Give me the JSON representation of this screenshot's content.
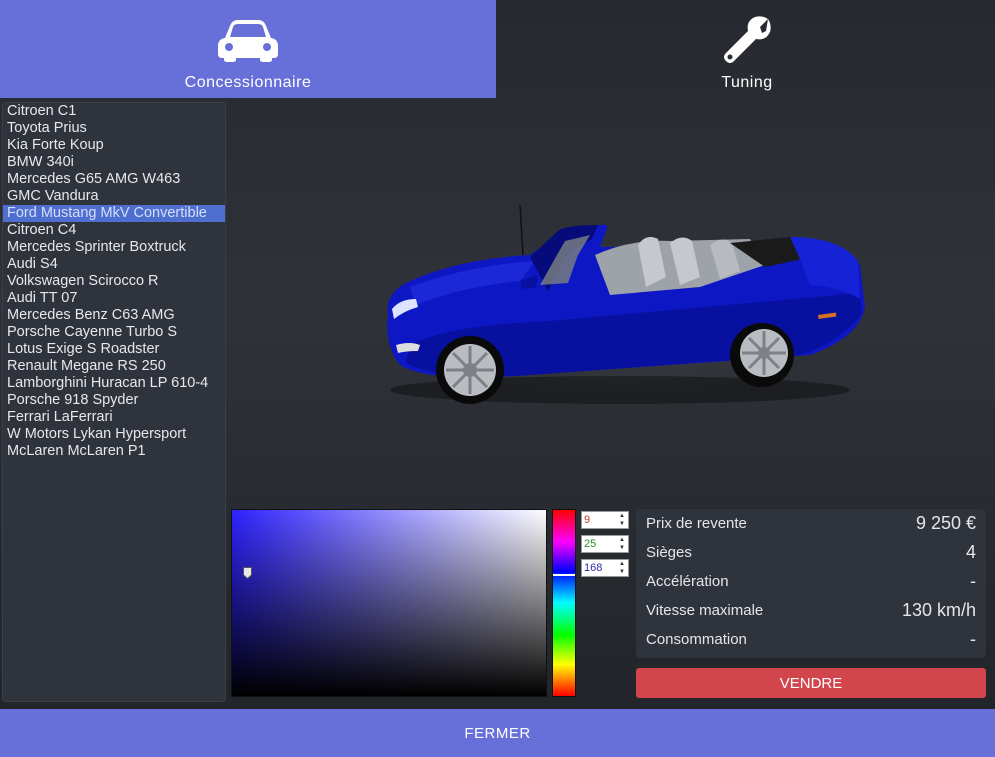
{
  "tabs": [
    {
      "label": "Concessionnaire",
      "icon": "car-icon",
      "active": true
    },
    {
      "label": "Tuning",
      "icon": "wrench-icon",
      "active": false
    }
  ],
  "vehicle_list": {
    "selected": "Ford Mustang MkV Convertible",
    "items": [
      "Citroen C1",
      "Toyota Prius",
      "Kia Forte Koup",
      "BMW 340i",
      "Mercedes G65 AMG W463",
      "GMC Vandura",
      "Ford Mustang MkV Convertible",
      "Citroen C4",
      "Mercedes Sprinter Boxtruck",
      "Audi S4",
      "Volkswagen Scirocco R",
      "Audi TT 07",
      "Mercedes Benz C63 AMG",
      "Porsche Cayenne Turbo S",
      "Lotus Exige S Roadster",
      "Renault Megane RS 250",
      "Lamborghini Huracan LP 610-4",
      "Porsche 918 Spyder",
      "Ferrari LaFerrari",
      "W Motors Lykan Hypersport",
      "McLaren McLaren P1"
    ]
  },
  "color_picker": {
    "red": "9",
    "green": "25",
    "blue": "168",
    "hue_color": "#0000ff",
    "selected_color": "#0919a8"
  },
  "stats": [
    {
      "label": "Prix de revente",
      "value": "9 250 €"
    },
    {
      "label": "Sièges",
      "value": "4"
    },
    {
      "label": "Accélération",
      "value": "-"
    },
    {
      "label": "Vitesse maximale",
      "value": "130 km/h"
    },
    {
      "label": "Consommation",
      "value": "-"
    }
  ],
  "buttons": {
    "sell": "VENDRE",
    "close": "FERMER"
  },
  "colors": {
    "accent": "#6670d8",
    "sell": "#d2454d",
    "selection": "#4f6fd0",
    "panel": "#2f333b",
    "car_body": "#0a14c8"
  }
}
